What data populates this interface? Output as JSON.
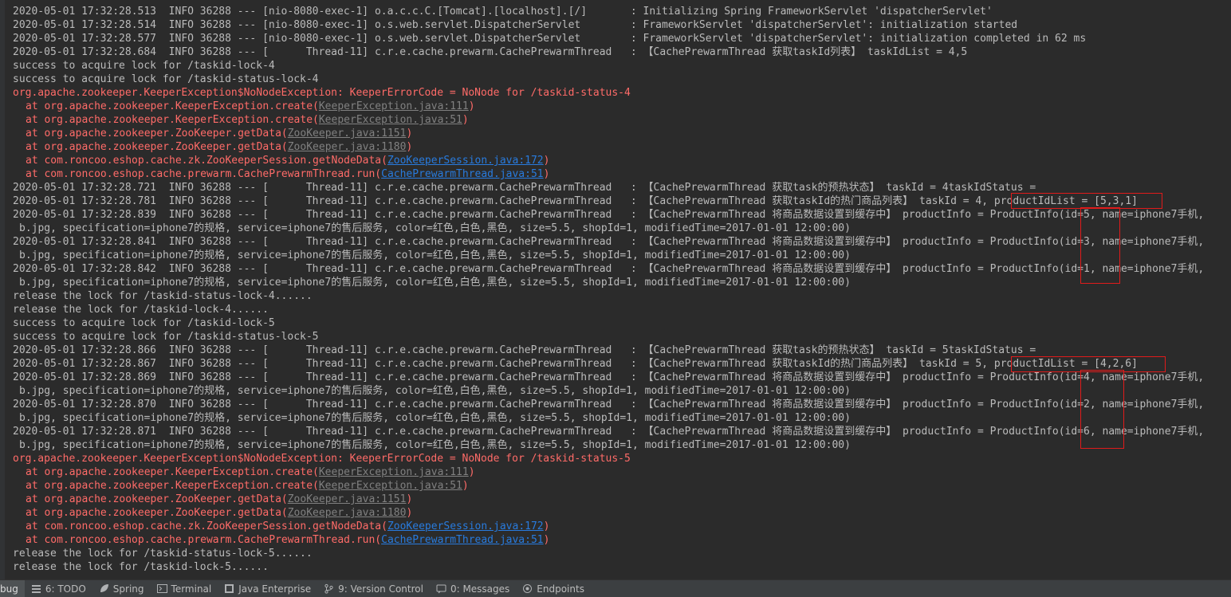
{
  "console": {
    "lines": [
      {
        "style": "info",
        "segments": [
          {
            "t": "2020-05-01 17:32:28.513  INFO 36288 --- [nio-8080-exec-1] o.a.c.c.C.[Tomcat].[localhost].[/]       : Initializing Spring FrameworkServlet 'dispatcherServlet'"
          }
        ]
      },
      {
        "style": "info",
        "segments": [
          {
            "t": "2020-05-01 17:32:28.514  INFO 36288 --- [nio-8080-exec-1] o.s.web.servlet.DispatcherServlet        : FrameworkServlet 'dispatcherServlet': initialization started"
          }
        ]
      },
      {
        "style": "info",
        "segments": [
          {
            "t": "2020-05-01 17:32:28.577  INFO 36288 --- [nio-8080-exec-1] o.s.web.servlet.DispatcherServlet        : FrameworkServlet 'dispatcherServlet': initialization completed in 62 ms"
          }
        ]
      },
      {
        "style": "info",
        "segments": [
          {
            "t": "2020-05-01 17:32:28.684  INFO 36288 --- [      Thread-11] c.r.e.cache.prewarm.CachePrewarmThread   : 【CachePrewarmThread 获取taskId列表】 taskIdList = 4,5"
          }
        ]
      },
      {
        "style": "info",
        "segments": [
          {
            "t": "success to acquire lock for /taskid-lock-4"
          }
        ]
      },
      {
        "style": "info",
        "segments": [
          {
            "t": "success to acquire lock for /taskid-status-lock-4"
          }
        ]
      },
      {
        "style": "err",
        "segments": [
          {
            "t": "org.apache.zookeeper.KeeperException$NoNodeException: KeeperErrorCode = NoNode for /taskid-status-4"
          }
        ]
      },
      {
        "style": "trace",
        "segments": [
          {
            "t": "at org.apache.zookeeper.KeeperException.create("
          },
          {
            "t": "KeeperException.java:111",
            "link": "grey"
          },
          {
            "t": ")"
          }
        ]
      },
      {
        "style": "trace",
        "segments": [
          {
            "t": "at org.apache.zookeeper.KeeperException.create("
          },
          {
            "t": "KeeperException.java:51",
            "link": "grey"
          },
          {
            "t": ")"
          }
        ]
      },
      {
        "style": "trace",
        "segments": [
          {
            "t": "at org.apache.zookeeper.ZooKeeper.getData("
          },
          {
            "t": "ZooKeeper.java:1151",
            "link": "grey"
          },
          {
            "t": ")"
          }
        ]
      },
      {
        "style": "trace",
        "segments": [
          {
            "t": "at org.apache.zookeeper.ZooKeeper.getData("
          },
          {
            "t": "ZooKeeper.java:1180",
            "link": "grey"
          },
          {
            "t": ")"
          }
        ]
      },
      {
        "style": "trace",
        "segments": [
          {
            "t": "at com.roncoo.eshop.cache.zk.ZooKeeperSession.getNodeData("
          },
          {
            "t": "ZooKeeperSession.java:172",
            "link": "blue"
          },
          {
            "t": ")"
          }
        ]
      },
      {
        "style": "trace",
        "segments": [
          {
            "t": "at com.roncoo.eshop.cache.prewarm.CachePrewarmThread.run("
          },
          {
            "t": "CachePrewarmThread.java:51",
            "link": "blue"
          },
          {
            "t": ")"
          }
        ]
      },
      {
        "style": "info",
        "segments": [
          {
            "t": "2020-05-01 17:32:28.721  INFO 36288 --- [      Thread-11] c.r.e.cache.prewarm.CachePrewarmThread   : 【CachePrewarmThread 获取task的预热状态】 taskId = 4taskIdStatus ="
          }
        ]
      },
      {
        "style": "info",
        "segments": [
          {
            "t": "2020-05-01 17:32:28.781  INFO 36288 --- [      Thread-11] c.r.e.cache.prewarm.CachePrewarmThread   : 【CachePrewarmThread 获取taskId的热门商品列表】 taskId = 4, productIdList = [5,3,1]"
          }
        ]
      },
      {
        "style": "info",
        "segments": [
          {
            "t": "2020-05-01 17:32:28.839  INFO 36288 --- [      Thread-11] c.r.e.cache.prewarm.CachePrewarmThread   : 【CachePrewarmThread 将商品数据设置到缓存中】 productInfo = ProductInfo(id=5, name=iphone7手机,"
          }
        ]
      },
      {
        "style": "cont",
        "segments": [
          {
            "t": "b.jpg, specification=iphone7的规格, service=iphone7的售后服务, color=红色,白色,黑色, size=5.5, shopId=1, modifiedTime=2017-01-01 12:00:00)"
          }
        ]
      },
      {
        "style": "info",
        "segments": [
          {
            "t": "2020-05-01 17:32:28.841  INFO 36288 --- [      Thread-11] c.r.e.cache.prewarm.CachePrewarmThread   : 【CachePrewarmThread 将商品数据设置到缓存中】 productInfo = ProductInfo(id=3, name=iphone7手机,"
          }
        ]
      },
      {
        "style": "cont",
        "segments": [
          {
            "t": "b.jpg, specification=iphone7的规格, service=iphone7的售后服务, color=红色,白色,黑色, size=5.5, shopId=1, modifiedTime=2017-01-01 12:00:00)"
          }
        ]
      },
      {
        "style": "info",
        "segments": [
          {
            "t": "2020-05-01 17:32:28.842  INFO 36288 --- [      Thread-11] c.r.e.cache.prewarm.CachePrewarmThread   : 【CachePrewarmThread 将商品数据设置到缓存中】 productInfo = ProductInfo(id=1, name=iphone7手机,"
          }
        ]
      },
      {
        "style": "cont",
        "segments": [
          {
            "t": "b.jpg, specification=iphone7的规格, service=iphone7的售后服务, color=红色,白色,黑色, size=5.5, shopId=1, modifiedTime=2017-01-01 12:00:00)"
          }
        ]
      },
      {
        "style": "info",
        "segments": [
          {
            "t": "release the lock for /taskid-status-lock-4......"
          }
        ]
      },
      {
        "style": "info",
        "segments": [
          {
            "t": "release the lock for /taskid-lock-4......"
          }
        ]
      },
      {
        "style": "info",
        "segments": [
          {
            "t": "success to acquire lock for /taskid-lock-5"
          }
        ]
      },
      {
        "style": "info",
        "segments": [
          {
            "t": "success to acquire lock for /taskid-status-lock-5"
          }
        ]
      },
      {
        "style": "info",
        "segments": [
          {
            "t": "2020-05-01 17:32:28.866  INFO 36288 --- [      Thread-11] c.r.e.cache.prewarm.CachePrewarmThread   : 【CachePrewarmThread 获取task的预热状态】 taskId = 5taskIdStatus ="
          }
        ]
      },
      {
        "style": "info",
        "segments": [
          {
            "t": "2020-05-01 17:32:28.867  INFO 36288 --- [      Thread-11] c.r.e.cache.prewarm.CachePrewarmThread   : 【CachePrewarmThread 获取taskId的热门商品列表】 taskId = 5, productIdList = [4,2,6]"
          }
        ]
      },
      {
        "style": "info",
        "segments": [
          {
            "t": "2020-05-01 17:32:28.869  INFO 36288 --- [      Thread-11] c.r.e.cache.prewarm.CachePrewarmThread   : 【CachePrewarmThread 将商品数据设置到缓存中】 productInfo = ProductInfo(id=4, name=iphone7手机,"
          }
        ]
      },
      {
        "style": "cont",
        "segments": [
          {
            "t": "b.jpg, specification=iphone7的规格, service=iphone7的售后服务, color=红色,白色,黑色, size=5.5, shopId=1, modifiedTime=2017-01-01 12:00:00)"
          }
        ]
      },
      {
        "style": "info",
        "segments": [
          {
            "t": "2020-05-01 17:32:28.870  INFO 36288 --- [      Thread-11] c.r.e.cache.prewarm.CachePrewarmThread   : 【CachePrewarmThread 将商品数据设置到缓存中】 productInfo = ProductInfo(id=2, name=iphone7手机,"
          }
        ]
      },
      {
        "style": "cont",
        "segments": [
          {
            "t": "b.jpg, specification=iphone7的规格, service=iphone7的售后服务, color=红色,白色,黑色, size=5.5, shopId=1, modifiedTime=2017-01-01 12:00:00)"
          }
        ]
      },
      {
        "style": "info",
        "segments": [
          {
            "t": "2020-05-01 17:32:28.871  INFO 36288 --- [      Thread-11] c.r.e.cache.prewarm.CachePrewarmThread   : 【CachePrewarmThread 将商品数据设置到缓存中】 productInfo = ProductInfo(id=6, name=iphone7手机,"
          }
        ]
      },
      {
        "style": "cont",
        "segments": [
          {
            "t": "b.jpg, specification=iphone7的规格, service=iphone7的售后服务, color=红色,白色,黑色, size=5.5, shopId=1, modifiedTime=2017-01-01 12:00:00)"
          }
        ]
      },
      {
        "style": "err",
        "segments": [
          {
            "t": "org.apache.zookeeper.KeeperException$NoNodeException: KeeperErrorCode = NoNode for /taskid-status-5"
          }
        ]
      },
      {
        "style": "trace",
        "segments": [
          {
            "t": "at org.apache.zookeeper.KeeperException.create("
          },
          {
            "t": "KeeperException.java:111",
            "link": "grey"
          },
          {
            "t": ")"
          }
        ]
      },
      {
        "style": "trace",
        "segments": [
          {
            "t": "at org.apache.zookeeper.KeeperException.create("
          },
          {
            "t": "KeeperException.java:51",
            "link": "grey"
          },
          {
            "t": ")"
          }
        ]
      },
      {
        "style": "trace",
        "segments": [
          {
            "t": "at org.apache.zookeeper.ZooKeeper.getData("
          },
          {
            "t": "ZooKeeper.java:1151",
            "link": "grey"
          },
          {
            "t": ")"
          }
        ]
      },
      {
        "style": "trace",
        "segments": [
          {
            "t": "at org.apache.zookeeper.ZooKeeper.getData("
          },
          {
            "t": "ZooKeeper.java:1180",
            "link": "grey"
          },
          {
            "t": ")"
          }
        ]
      },
      {
        "style": "trace",
        "segments": [
          {
            "t": "at com.roncoo.eshop.cache.zk.ZooKeeperSession.getNodeData("
          },
          {
            "t": "ZooKeeperSession.java:172",
            "link": "blue"
          },
          {
            "t": ")"
          }
        ]
      },
      {
        "style": "trace",
        "segments": [
          {
            "t": "at com.roncoo.eshop.cache.prewarm.CachePrewarmThread.run("
          },
          {
            "t": "CachePrewarmThread.java:51",
            "link": "blue"
          },
          {
            "t": ")"
          }
        ]
      },
      {
        "style": "info",
        "segments": [
          {
            "t": "release the lock for /taskid-status-lock-5......"
          }
        ]
      },
      {
        "style": "info",
        "segments": [
          {
            "t": "release the lock for /taskid-lock-5......"
          }
        ]
      }
    ]
  },
  "statusbar": {
    "items": [
      {
        "label": "bug",
        "icon": "debug-icon",
        "active": true
      },
      {
        "label": "6: TODO",
        "icon": "todo-icon"
      },
      {
        "label": "Spring",
        "icon": "spring-leaf-icon"
      },
      {
        "label": "Terminal",
        "icon": "terminal-icon"
      },
      {
        "label": "Java Enterprise",
        "icon": "java-enterprise-icon"
      },
      {
        "label": "9: Version Control",
        "icon": "version-control-icon"
      },
      {
        "label": "0: Messages",
        "icon": "messages-icon"
      },
      {
        "label": "Endpoints",
        "icon": "endpoints-icon"
      }
    ]
  },
  "colors": {
    "background": "#2b2b2b",
    "text": "#bbbbbb",
    "error": "#ff6b68",
    "link": "#287bde",
    "annotation": "#e01b1b"
  }
}
